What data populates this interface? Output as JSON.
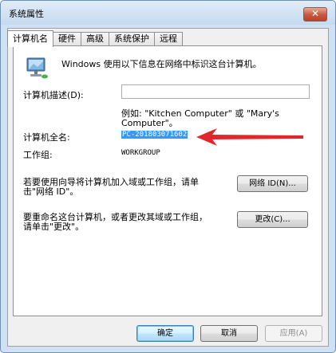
{
  "window": {
    "title": "系统属性",
    "close_glyph": "✕"
  },
  "tabs": [
    {
      "label": "计算机名",
      "active": true
    },
    {
      "label": "硬件",
      "active": false
    },
    {
      "label": "高级",
      "active": false
    },
    {
      "label": "系统保护",
      "active": false
    },
    {
      "label": "远程",
      "active": false
    }
  ],
  "panel": {
    "intro_text": "Windows 使用以下信息在网络中标识这台计算机。",
    "description_label": "计算机描述(D):",
    "description_value": "",
    "example_line1": "例如: \"Kitchen Computer\" 或 \"Mary's",
    "example_line2": "Computer\"。",
    "fullname_label": "计算机全名:",
    "fullname_value": "PC-201803071602",
    "workgroup_label": "工作组:",
    "workgroup_value": "WORKGROUP",
    "network_text_line1": "若要使用向导将计算机加入域或工作组，请单",
    "network_text_line2": "击\"网络 ID\"。",
    "network_button": "网络 ID(N)...",
    "rename_text_line1": "要重命名这台计算机，或者更改其域或工作组，",
    "rename_text_line2": "请单击\"更改\"。",
    "change_button": "更改(C)..."
  },
  "footer": {
    "ok_label": "确定",
    "cancel_label": "取消",
    "apply_label": "应用(A)"
  },
  "colors": {
    "selection": "#3399ff",
    "arrow": "#e3262b",
    "title_bar": "#cfe1f3"
  },
  "icons": {
    "computer": "computer-network-icon",
    "close": "close-icon",
    "annotation": "red-arrow-annotation"
  }
}
